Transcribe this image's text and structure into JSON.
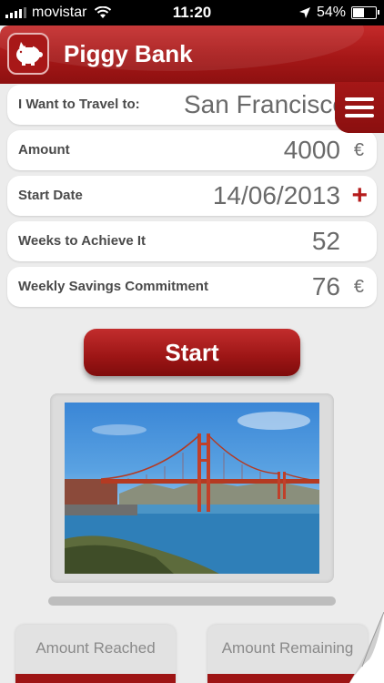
{
  "status_bar": {
    "carrier": "movistar",
    "time": "11:20",
    "battery": "54%",
    "battery_level": 0.54
  },
  "header": {
    "title": "Piggy Bank",
    "icon": "piggy-bank-icon",
    "menu_icon": "hamburger-menu-icon"
  },
  "form": {
    "destination": {
      "label": "I Want to Travel to:",
      "value": "San Francisco"
    },
    "amount": {
      "label": "Amount",
      "value": "4000",
      "unit": "€"
    },
    "start_date": {
      "label": "Start Date",
      "value": "14/06/2013",
      "action": "+"
    },
    "weeks": {
      "label": "Weeks to Achieve It",
      "value": "52"
    },
    "weekly": {
      "label": "Weekly Savings Commitment",
      "value": "76",
      "unit": "€"
    }
  },
  "start_button": {
    "label": "Start"
  },
  "photo": {
    "subject": "golden-gate-bridge-image"
  },
  "tiles": {
    "reached": {
      "label": "Amount Reached"
    },
    "remaining": {
      "label": "Amount Remaining"
    }
  },
  "colors": {
    "brand_red": "#a51717",
    "background": "#ececec",
    "text_gray": "#6a6a6a"
  }
}
